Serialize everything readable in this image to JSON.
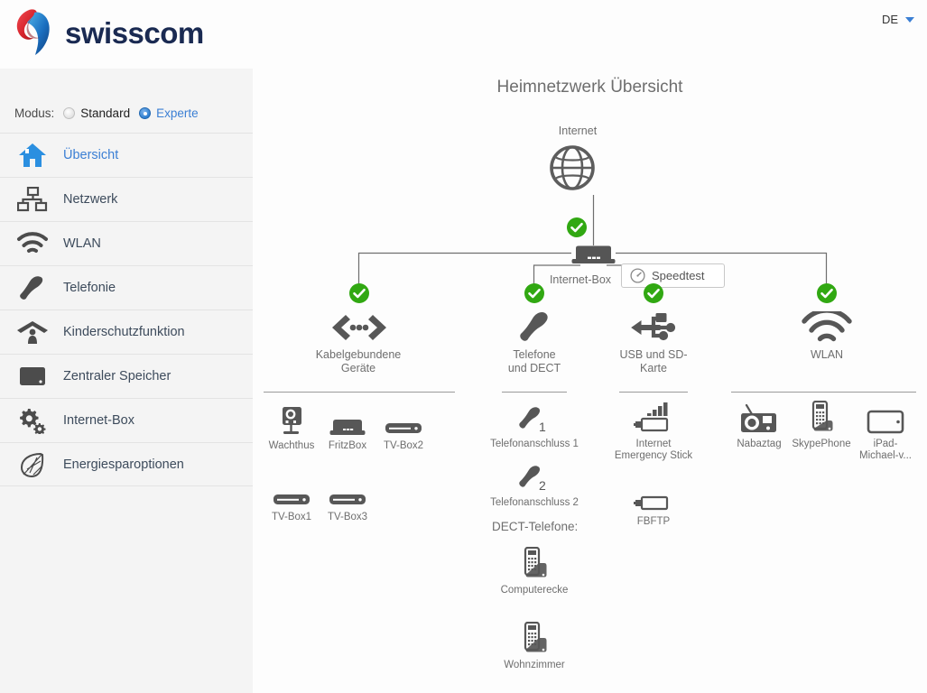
{
  "header": {
    "brand": "swisscom",
    "language": "DE",
    "caret_icon": "chevron-down-icon"
  },
  "sidebar": {
    "mode": {
      "label": "Modus:",
      "options": [
        {
          "label": "Standard",
          "selected": false
        },
        {
          "label": "Experte",
          "selected": true
        }
      ]
    },
    "items": [
      {
        "label": "Übersicht",
        "icon": "home-icon",
        "active": true
      },
      {
        "label": "Netzwerk",
        "icon": "network-icon",
        "active": false
      },
      {
        "label": "WLAN",
        "icon": "wifi-icon",
        "active": false
      },
      {
        "label": "Telefonie",
        "icon": "phone-icon",
        "active": false
      },
      {
        "label": "Kinderschutzfunktion",
        "icon": "parental-control-icon",
        "active": false
      },
      {
        "label": "Zentraler Speicher",
        "icon": "storage-icon",
        "active": false
      },
      {
        "label": "Internet-Box",
        "icon": "gears-icon",
        "active": false
      },
      {
        "label": "Energiesparoptionen",
        "icon": "leaf-icon",
        "active": false
      }
    ]
  },
  "main": {
    "title": "Heimnetzwerk Übersicht",
    "internet": {
      "label": "Internet",
      "icon": "globe-icon",
      "status": "ok"
    },
    "speedtest": {
      "label": "Speedtest",
      "icon": "speedometer-icon"
    },
    "router": {
      "label": "Internet-Box",
      "icon": "router-icon"
    },
    "categories": [
      {
        "id": "wired",
        "label": "Kabelgebundene\nGeräte",
        "label_line1": "Kabelgebundene",
        "label_line2": "Geräte",
        "icon": "wired-devices-icon",
        "status": "ok",
        "devices": [
          {
            "name": "Wachthus",
            "icon": "webcam-icon"
          },
          {
            "name": "FritzBox",
            "icon": "modem-icon"
          },
          {
            "name": "TV-Box2",
            "icon": "tvbox-icon"
          },
          {
            "name": "TV-Box1",
            "icon": "tvbox-icon"
          },
          {
            "name": "TV-Box3",
            "icon": "tvbox-icon"
          }
        ]
      },
      {
        "id": "telephony",
        "label_line1": "Telefone",
        "label_line2": "und DECT",
        "icon": "handset-icon",
        "status": "ok",
        "devices": [
          {
            "name": "Telefonanschluss 1",
            "icon": "handset-1-icon"
          },
          {
            "name": "Telefonanschluss 2",
            "icon": "handset-2-icon"
          }
        ],
        "sub_heading": "DECT-Telefone:",
        "dect_devices": [
          {
            "name": "Computerecke",
            "icon": "dect-phone-icon"
          },
          {
            "name": "Wohnzimmer",
            "icon": "dect-phone-icon"
          }
        ]
      },
      {
        "id": "usb",
        "label_line1": "USB und SD-",
        "label_line2": "Karte",
        "icon": "usb-icon",
        "status": "ok",
        "devices": [
          {
            "name": "Internet\nEmergency Stick",
            "name_line1": "Internet",
            "name_line2": "Emergency Stick",
            "icon": "usb-stick-signal-icon"
          },
          {
            "name": "FBFTP",
            "icon": "usb-stick-icon"
          }
        ]
      },
      {
        "id": "wlan",
        "label_line1": "WLAN",
        "label_line2": "",
        "icon": "wifi-icon",
        "status": "ok",
        "devices": [
          {
            "name": "Nabaztag",
            "icon": "rabbit-device-icon"
          },
          {
            "name": "SkypePhone",
            "icon": "cordless-phone-icon"
          },
          {
            "name": "iPad-\nMichael-v...",
            "name_line1": "iPad-",
            "name_line2": "Michael-v...",
            "icon": "tablet-icon"
          }
        ]
      }
    ]
  },
  "colors": {
    "accent_blue": "#3b7fd4",
    "status_green": "#31a812",
    "icon_gray": "#575757",
    "text_gray": "#6e6e6e",
    "sidebar_bg": "#f4f4f4",
    "page_bg": "#fdfdfd",
    "brand_navy": "#1a2a52",
    "brand_red": "#d6232b"
  }
}
